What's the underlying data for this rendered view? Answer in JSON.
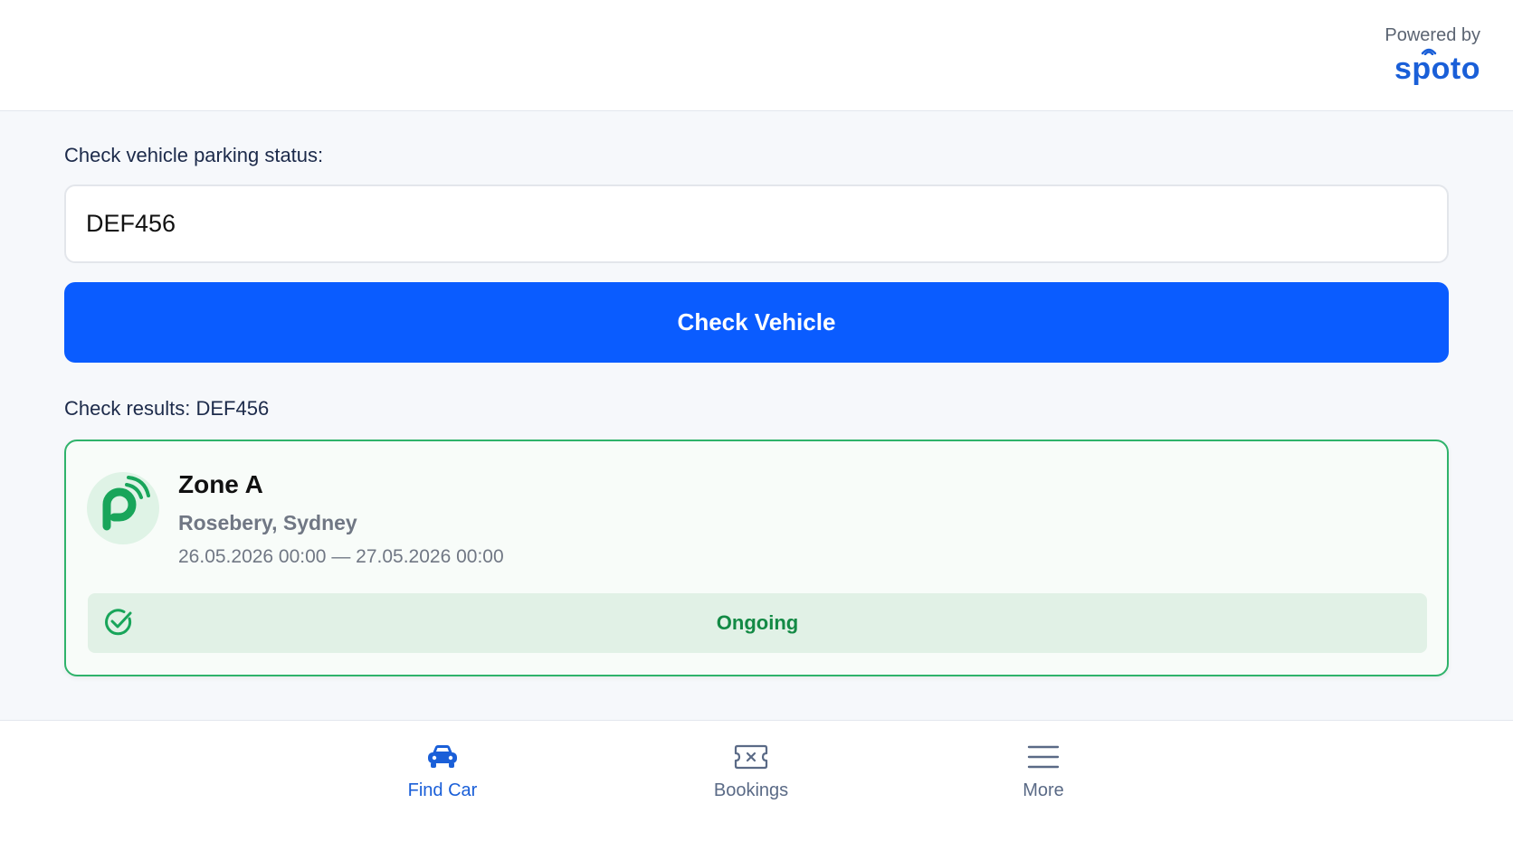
{
  "header": {
    "powered_by_label": "Powered by",
    "brand_name": "spoto",
    "brand_color": "#1a5fd8"
  },
  "search": {
    "prompt_label": "Check vehicle parking status:",
    "plate_value": "DEF456",
    "button_label": "Check Vehicle",
    "button_color": "#0a5cff"
  },
  "results": {
    "heading": "Check results: DEF456",
    "card": {
      "logo_icon": "parking-signal-icon",
      "zone_name": "Zone A",
      "location": "Rosebery, Sydney",
      "period": "26.05.2026 00:00 — 27.05.2026 00:00",
      "status_icon": "check-circle-icon",
      "status_label": "Ongoing",
      "status_color": "#138a45",
      "border_color": "#2fb36b"
    }
  },
  "nav": {
    "items": [
      {
        "label": "Find Car",
        "icon": "car-icon",
        "active": true
      },
      {
        "label": "Bookings",
        "icon": "ticket-icon",
        "active": false
      },
      {
        "label": "More",
        "icon": "menu-icon",
        "active": false
      }
    ],
    "active_color": "#1a5fd8",
    "inactive_color": "#5a6a86"
  }
}
